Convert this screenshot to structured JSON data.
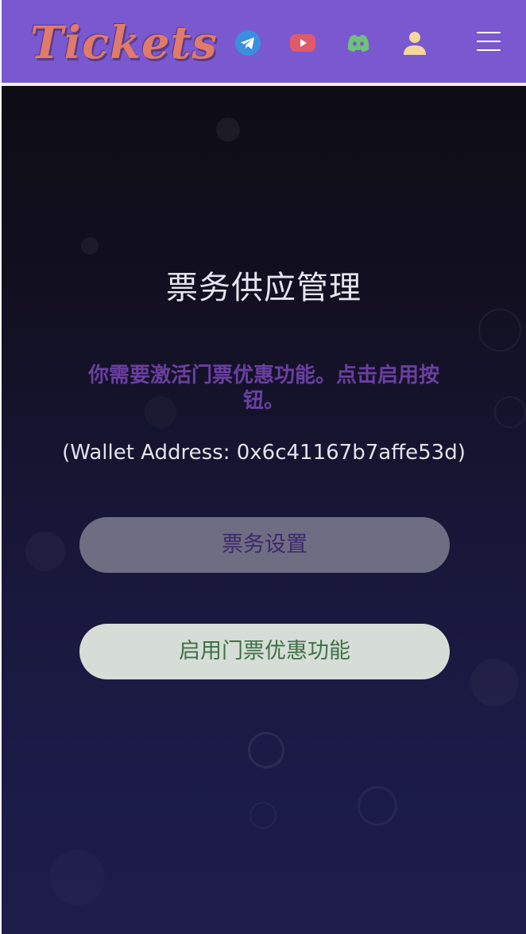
{
  "header": {
    "logo_text": "Tickets",
    "icons": [
      {
        "name": "telegram-icon",
        "color": "#3a8fe0"
      },
      {
        "name": "youtube-icon",
        "color": "#e05a6a"
      },
      {
        "name": "discord-icon",
        "color": "#6ec27a"
      },
      {
        "name": "user-icon",
        "color": "#f6d79a"
      },
      {
        "name": "menu-icon",
        "color": "#ffffff"
      }
    ],
    "background_color": "#7a58d0"
  },
  "main": {
    "title": "票务供应管理",
    "notice": "你需要激活门票优惠功能。点击启用按钮。",
    "wallet_text": "(Wallet Address: 0x6c41167b7affe53d)",
    "buttons": {
      "settings_label": "票务设置",
      "enable_label": "启用门票优惠功能"
    },
    "colors": {
      "notice": "#6a3fa0",
      "settings_button_bg": "#6f6d82",
      "settings_button_text": "#3a2a6e",
      "enable_button_bg": "#d6ddd6",
      "enable_button_text": "#3f7048"
    }
  }
}
